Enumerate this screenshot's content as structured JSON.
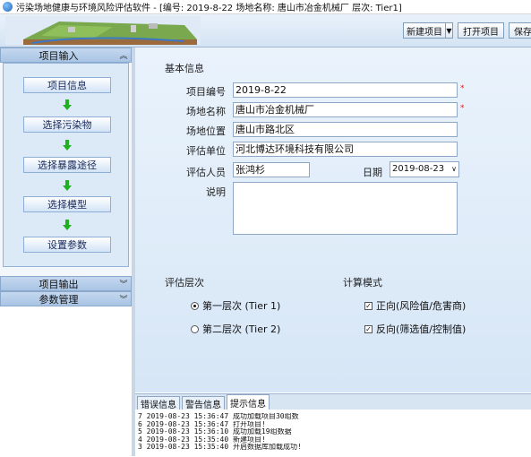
{
  "title": "污染场地健康与环境风险评估软件 - [编号: 2019-8-22   场地名称: 唐山市冶金机械厂   层次: Tier1]",
  "toolbar": {
    "new_project": "新建项目",
    "open_project": "打开项目",
    "save": "保存"
  },
  "sidebar": {
    "project_input": "项目输入",
    "project_output": "项目输出",
    "param_manage": "参数管理",
    "steps": [
      "项目信息",
      "选择污染物",
      "选择暴露途径",
      "选择模型",
      "设置参数"
    ]
  },
  "form": {
    "group_basic": "基本信息",
    "project_id_label": "项目编号",
    "project_id_value": "2019-8-22",
    "site_name_label": "场地名称",
    "site_name_value": "唐山市冶金机械厂",
    "site_location_label": "场地位置",
    "site_location_value": "唐山市路北区",
    "eval_unit_label": "评估单位",
    "eval_unit_value": "河北博达环境科技有限公司",
    "evaluator_label": "评估人员",
    "evaluator_value": "张鸿杉",
    "date_label": "日期",
    "date_value": "2019-08-23",
    "notes_label": "说明",
    "notes_value": "",
    "required_mark": "*"
  },
  "eval_level": {
    "title": "评估层次",
    "tier1": "第一层次 (Tier 1)",
    "tier2": "第二层次 (Tier 2)",
    "selected": "tier1"
  },
  "calc_mode": {
    "title": "计算模式",
    "forward": "正向(风险值/危害商)",
    "reverse": "反向(筛选值/控制值)"
  },
  "messages": {
    "tabs": [
      "错误信息",
      "警告信息",
      "提示信息"
    ],
    "active_tab": 2,
    "lines": [
      "7 2019-08-23 15:36:47 成功加载项目30组数",
      "6 2019-08-23 15:36:47 打开项目!",
      "5 2019-08-23 15:36:10 成功加载19组数据",
      "4 2019-08-23 15:35:40 新建项目!",
      "3 2019-08-23 15:35:40 开启数据库加载成功!"
    ]
  },
  "colors": {
    "accent": "#a9c4e4",
    "panel": "#dce9f7",
    "required": "#e02020",
    "arrow": "#22b022"
  }
}
